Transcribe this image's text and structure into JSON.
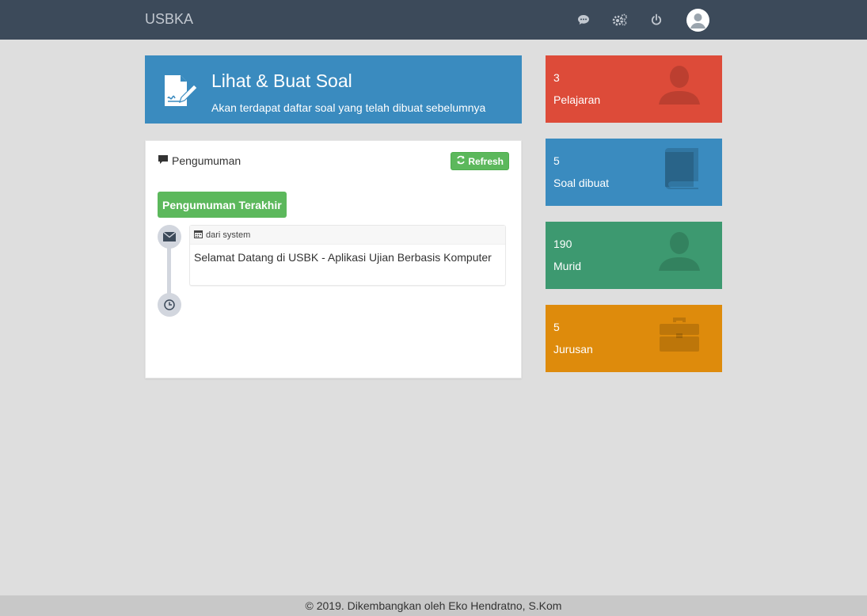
{
  "navbar": {
    "brand": "USBKA",
    "icons": [
      "chat-icon",
      "gears-icon",
      "power-icon",
      "user-avatar"
    ]
  },
  "hero": {
    "title": "Lihat & Buat Soal",
    "subtitle": "Akan terdapat daftar soal yang telah dibuat sebelumnya",
    "color": "#3a8bbf"
  },
  "panel": {
    "title": "Pengumuman",
    "refresh_label": "Refresh",
    "timeline_label": "Pengumuman Terakhir",
    "items": [
      {
        "from": "dari system",
        "message": "Selamat Datang di USBK - Aplikasi Ujian Berbasis Komputer"
      }
    ]
  },
  "stats": [
    {
      "value": "3",
      "label": "Pelajaran",
      "color": "#dd4b39",
      "icon": "user-icon"
    },
    {
      "value": "5",
      "label": "Soal dibuat",
      "color": "#3a8bbf",
      "icon": "book-icon"
    },
    {
      "value": "190",
      "label": "Murid",
      "color": "#3d9970",
      "icon": "user-icon"
    },
    {
      "value": "5",
      "label": "Jurusan",
      "color": "#de8b0c",
      "icon": "briefcase-icon"
    }
  ],
  "footer": {
    "text": "© 2019. Dikembangkan oleh Eko Hendratno, S.Kom"
  }
}
